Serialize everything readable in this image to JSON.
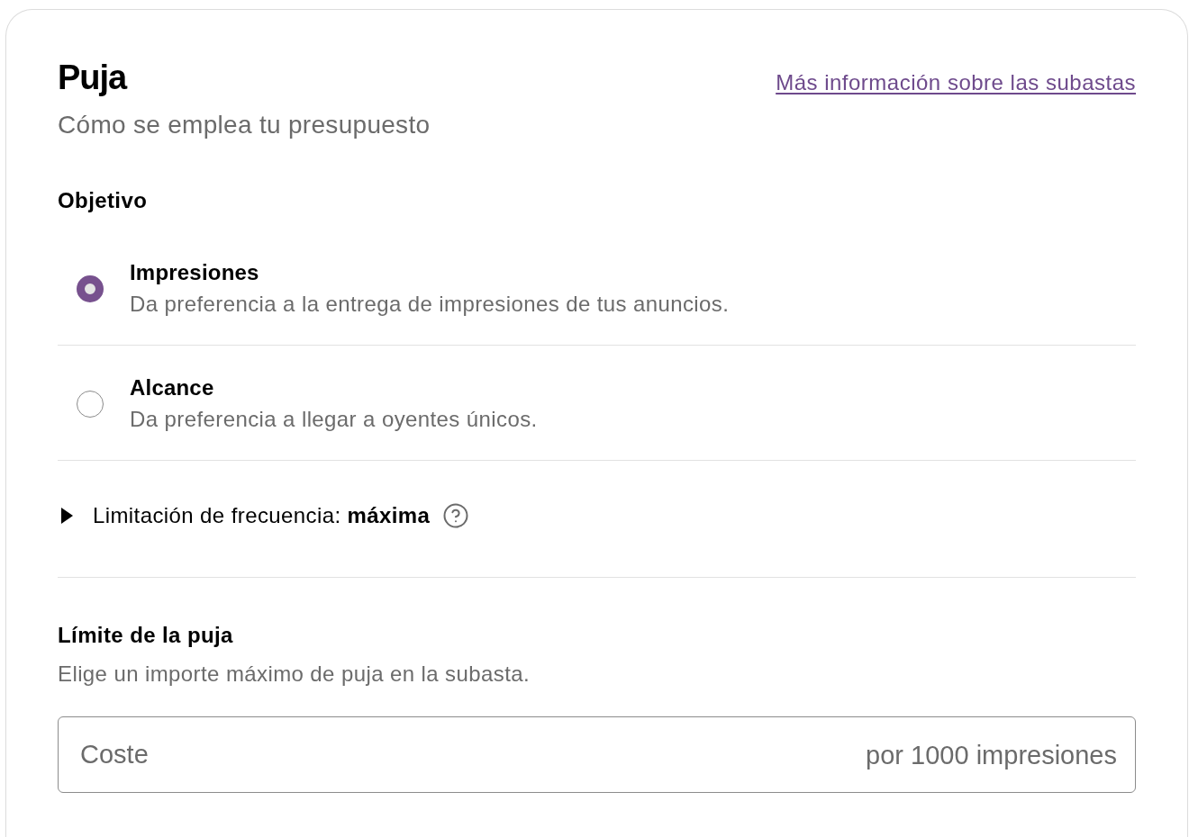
{
  "header": {
    "title": "Puja",
    "subtitle": "Cómo se emplea tu presupuesto",
    "link": "Más información sobre las subastas"
  },
  "objective": {
    "heading": "Objetivo",
    "options": [
      {
        "label": "Impresiones",
        "description": "Da preferencia a la entrega de impresiones de tus anuncios.",
        "selected": true
      },
      {
        "label": "Alcance",
        "description": "Da preferencia a llegar a oyentes únicos.",
        "selected": false
      }
    ]
  },
  "frequency_cap": {
    "label": "Limitación de frecuencia: **máxima**",
    "expanded": false
  },
  "bid_limit": {
    "heading": "Límite de la puja",
    "description": "Elige un importe máximo de puja en la subasta.",
    "field": {
      "placeholder": "Coste",
      "suffix": "por 1000 impresiones"
    }
  }
}
